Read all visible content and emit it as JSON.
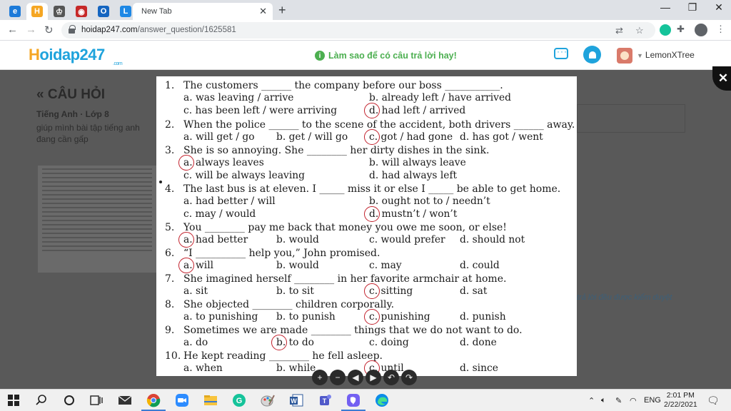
{
  "browser": {
    "tabs": [
      {
        "icon": "edge-icon",
        "color": "#1c7ad9",
        "label": "e"
      },
      {
        "icon": "hoidap-h-icon",
        "color": "#f5a623",
        "label": "H"
      },
      {
        "icon": "tab-favicon-icon",
        "color": "#555555",
        "label": "♔"
      },
      {
        "icon": "tab-favicon-icon",
        "color": "#c62828",
        "label": "◉"
      },
      {
        "icon": "outlook-icon",
        "color": "#1565c0",
        "label": "O"
      },
      {
        "icon": "tab-favicon-icon",
        "color": "#1e88e5",
        "label": "L"
      }
    ],
    "active_tab_title": "New Tab",
    "url_host": "hoidap247.com",
    "url_path": "/answer_question/1625581"
  },
  "site": {
    "logo_main": "oidap247",
    "logo_h": "H",
    "logo_com": ".com",
    "tip": "Làm sao để có câu trả lời hay!",
    "username": "LemonXTree"
  },
  "page": {
    "section_title": "« CÂU HỎI",
    "subject": "Tiếng Anh · Lớp 8",
    "question_text": "giúp mình bài tập tiếng anh đang cần gấp",
    "note": "trả lời đều được kiểm duyệt"
  },
  "worksheet": {
    "questions": [
      {
        "n": "1.",
        "text": "The customers ______ the company before our boss ___________.",
        "options": [
          "a. was leaving / arrive",
          "b. already left / have arrived",
          "c. has been left / were arriving",
          "d. had left / arrived"
        ],
        "layout": "two-col",
        "circled": 3
      },
      {
        "n": "2.",
        "text": "When the police ______ to the scene of the accident, both drivers ______ away.",
        "options": [
          "a. will get / go",
          "b. get / will go",
          "c. got / had gone",
          "d. has got / went"
        ],
        "layout": "four-col",
        "circled": 2
      },
      {
        "n": "3.",
        "text": "She is so annoying. She ________ her dirty dishes in the sink.",
        "options": [
          "a. always leaves",
          "b. will always leave",
          "c. will be always leaving",
          "d. had always left"
        ],
        "layout": "two-col",
        "circled": 0
      },
      {
        "n": "4.",
        "text": "The last bus is at eleven. I _____ miss it or else I _____ be able to get home.",
        "options": [
          "a. had better / will",
          "b. ought not to / needn’t",
          "c. may / would",
          "d. mustn’t / won’t"
        ],
        "layout": "two-col",
        "circled": 3
      },
      {
        "n": "5.",
        "text": "You ________ pay me back that money you owe me soon, or else!",
        "options": [
          "a. had better",
          "b. would",
          "c. would prefer",
          "d. should not"
        ],
        "layout": "four-col",
        "circled": 0
      },
      {
        "n": "6.",
        "text": "“I __________ help you,” John promised.",
        "options": [
          "a. will",
          "b. would",
          "c. may",
          "d. could"
        ],
        "layout": "four-col",
        "circled": 0
      },
      {
        "n": "7.",
        "text": "She imagined herself ________ in her favorite armchair at home.",
        "options": [
          "a. sit",
          "b. to sit",
          "c. sitting",
          "d. sat"
        ],
        "layout": "four-col",
        "circled": 2
      },
      {
        "n": "8.",
        "text": "She objected ________ children corporally.",
        "options": [
          "a. to punishing",
          "b. to punish",
          "c. punishing",
          "d. punish"
        ],
        "layout": "four-col",
        "circled": 2
      },
      {
        "n": "9.",
        "text": "Sometimes we are made ________ things that we do not want to do.",
        "options": [
          "a. do",
          "b. to do",
          "c. doing",
          "d. done"
        ],
        "layout": "four-col",
        "circled": 1
      },
      {
        "n": "10.",
        "text": "He kept reading ________ he fell asleep.",
        "options": [
          "a. when",
          "b. while",
          "c. until",
          "d. since"
        ],
        "layout": "four-col",
        "circled": 2
      }
    ]
  },
  "viewer_controls": [
    "+",
    "−",
    "◀",
    "▶",
    "↶",
    "↷"
  ],
  "taskbar": {
    "lang": "ENG",
    "time": "2:01 PM",
    "date": "2/22/2021"
  },
  "colors": {
    "accent": "#1fa3dc",
    "tip_green": "#4caf50",
    "circle_red": "#c2222d"
  }
}
